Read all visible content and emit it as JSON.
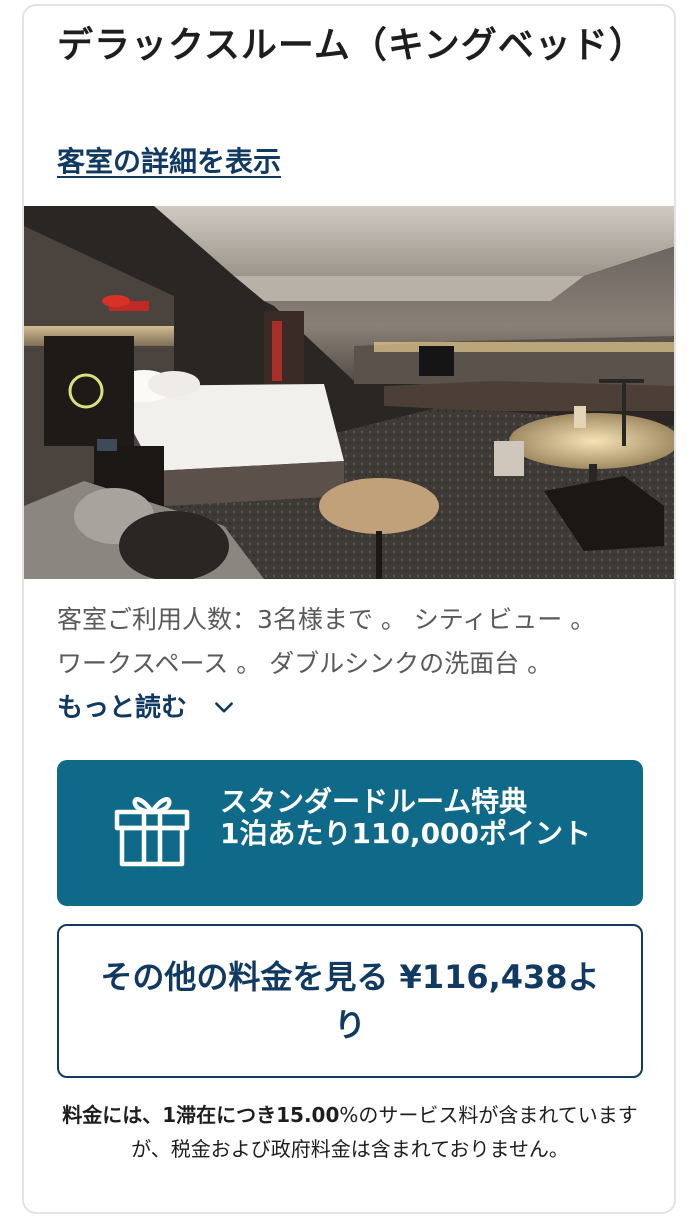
{
  "room": {
    "title": "デラックスルーム（キングベッド）",
    "details_link": "客室の詳細を表示",
    "image_alt": "Deluxe king room with bed, lounge seating, desk and round table",
    "description": "客室ご利用人数：3名様まで 。 シティビュー 。 ワークスペース 。 ダブルシンクの洗面台 。",
    "read_more": "もっと読む"
  },
  "points_offer": {
    "icon": "gift-icon",
    "line1": "スタンダードルーム特典",
    "line2": "1泊あたり110,000ポイント"
  },
  "other_rates": {
    "label": "その他の料金を見る ¥116,438より"
  },
  "fee_note": {
    "bold": "料金には、1滞在につき15.00",
    "regular": "%のサービス料が含まれていますが、税金および政府料金は含まれておりません。"
  },
  "colors": {
    "brand_navy": "#103a62",
    "points_teal": "#0f6a8a",
    "text_dark": "#1e1e1e",
    "text_muted": "#5a5a5a"
  }
}
